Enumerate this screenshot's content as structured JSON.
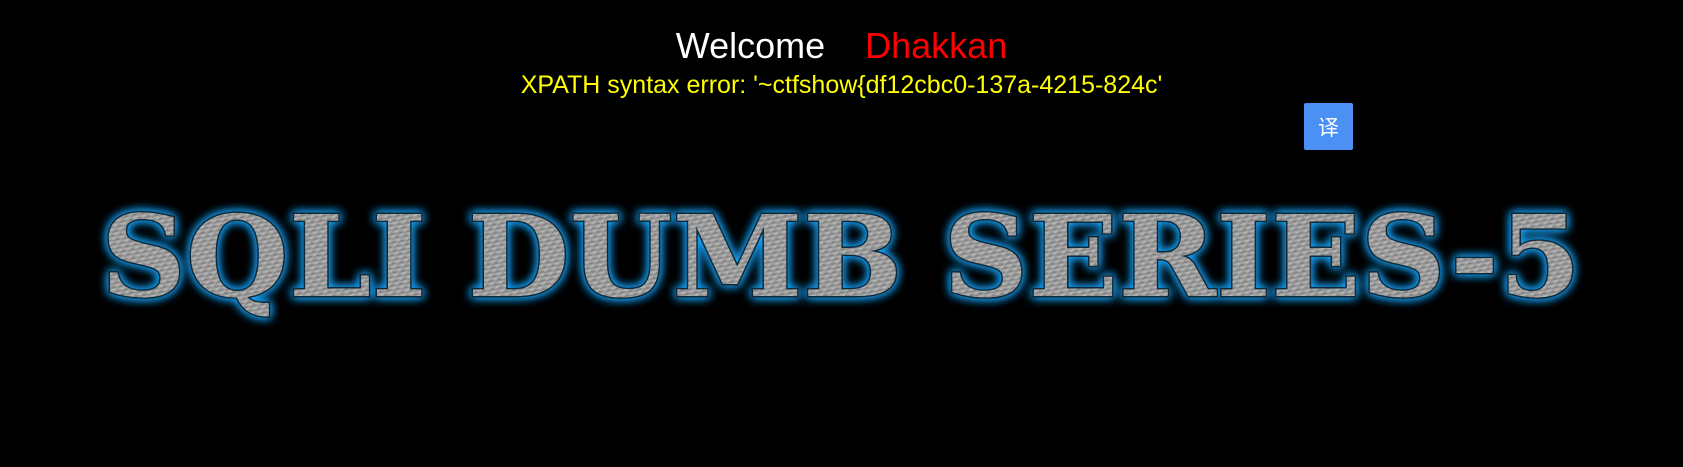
{
  "header": {
    "welcome": "Welcome",
    "username": "Dhakkan",
    "error_message": "XPATH syntax error: '~ctfshow{df12cbc0-137a-4215-824c'"
  },
  "translate_button": {
    "label": "译"
  },
  "banner": {
    "title": "SQLI DUMB SERIES-5"
  },
  "colors": {
    "background": "#000000",
    "welcome": "#ffffff",
    "username": "#ff0000",
    "error": "#ffff00",
    "button": "#4a90f5",
    "banner_glow": "#1aa6ff",
    "banner_metal": "#9a9a9a"
  }
}
